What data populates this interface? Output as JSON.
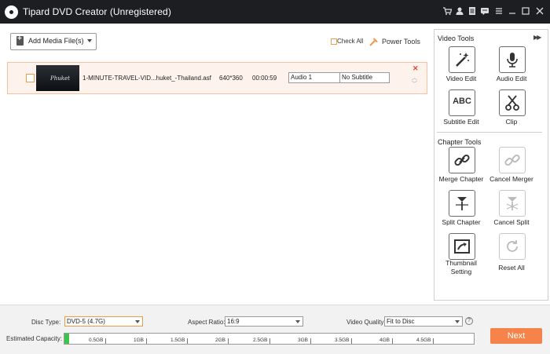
{
  "window": {
    "title": "Tipard DVD Creator (Unregistered)"
  },
  "titlebar_icons": [
    "cart-icon",
    "user-icon",
    "document-icon",
    "chat-icon",
    "minimize-icon",
    "maximize-icon",
    "close-icon"
  ],
  "toolbar": {
    "add_media_label": "Add Media File(s)",
    "check_all_label": "Check All",
    "power_tools_label": "Power Tools"
  },
  "file_row": {
    "thumbnail_text": "Phuket",
    "file_name": "1-MINUTE-TRAVEL-VID...huket_-Thailand.asf",
    "resolution": "640*360",
    "duration": "00:00:59",
    "audio_track": "Audio 1",
    "subtitle": "No Subtitle"
  },
  "video_tools": {
    "title": "Video Tools",
    "items": [
      {
        "label": "Video Edit",
        "icon": "magic-wand-icon"
      },
      {
        "label": "Audio Edit",
        "icon": "microphone-icon"
      },
      {
        "label": "Subtitle Edit",
        "icon": "abc-icon"
      },
      {
        "label": "Clip",
        "icon": "scissors-icon"
      }
    ]
  },
  "chapter_tools": {
    "title": "Chapter Tools",
    "items": [
      {
        "label": "Merge Chapter",
        "icon": "link-icon"
      },
      {
        "label": "Cancel Merger",
        "icon": "unlink-icon"
      },
      {
        "label": "Split Chapter",
        "icon": "split-icon"
      },
      {
        "label": "Cancel Split",
        "icon": "cancel-split-icon"
      },
      {
        "label_line1": "Thumbnail",
        "label_line2": "Setting",
        "icon": "thumbnail-icon"
      },
      {
        "label": "Reset All",
        "icon": "reset-icon"
      }
    ]
  },
  "bottom": {
    "disc_type_label": "Disc Type:",
    "disc_type_value": "DVD-5 (4.7G)",
    "aspect_ratio_label": "Aspect Ratio:",
    "aspect_ratio_value": "16:9",
    "video_quality_label": "Video Quality:",
    "video_quality_value": "Fit to Disc",
    "help_glyph": "?",
    "estimated_capacity_label": "Estimated Capacity:",
    "capacity_used_fraction": 0.011,
    "capacity_ticks": [
      "0.5GB",
      "1GB",
      "1.5GB",
      "2GB",
      "2.5GB",
      "3GB",
      "3.5GB",
      "4GB",
      "4.5GB"
    ],
    "next_label": "Next"
  },
  "colors": {
    "accent": "#f6844a",
    "capacity_fill": "#3fc34a",
    "titlebar": "#1d1e22"
  }
}
